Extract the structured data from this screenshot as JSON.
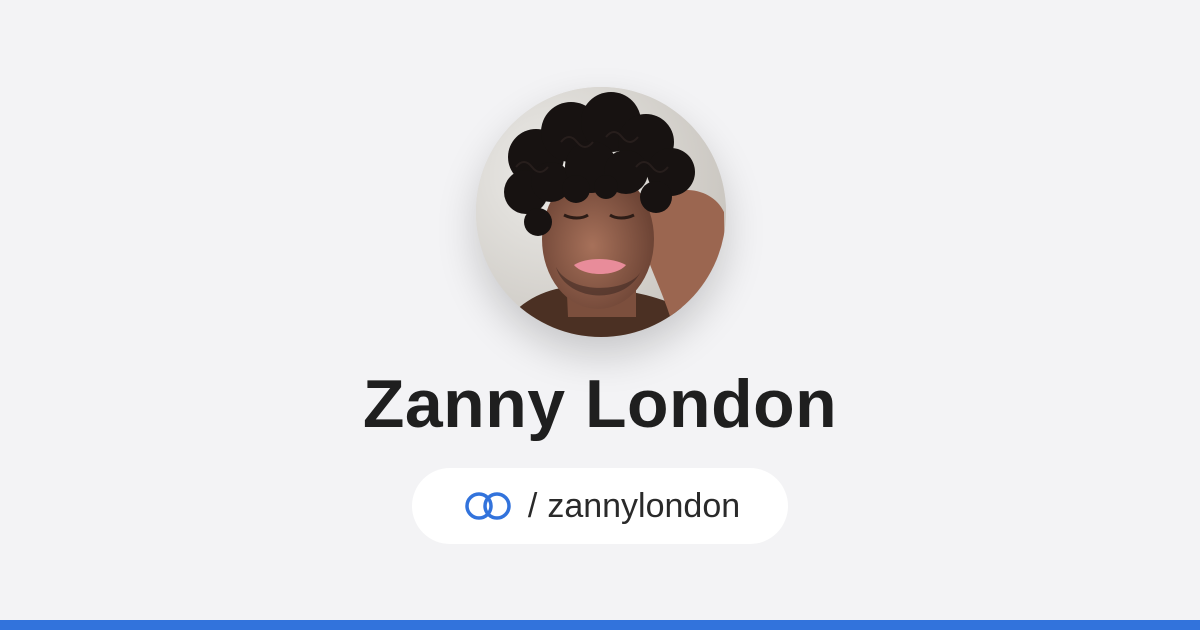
{
  "profile": {
    "name": "Zanny London",
    "handle_separator": "/",
    "handle": "zannylondon",
    "avatar_alt": "Profile photo"
  },
  "icons": {
    "link_icon": "linked-rings-icon"
  },
  "colors": {
    "background": "#f3f3f5",
    "accent": "#3273dc",
    "name_text": "#1f1f1f",
    "pill_background": "#ffffff"
  }
}
